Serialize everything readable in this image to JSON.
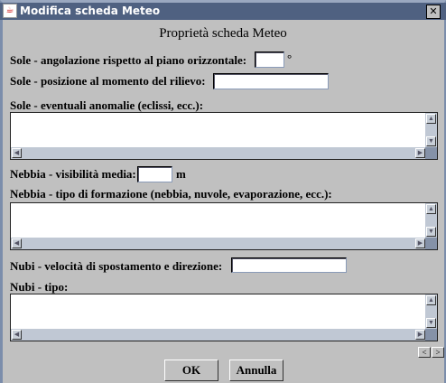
{
  "window": {
    "title": "Modifica scheda Meteo"
  },
  "heading": "Proprietà scheda Meteo",
  "fields": {
    "sole_angolazione": {
      "label": "Sole - angolazione rispetto al piano orizzontale:",
      "value": "",
      "unit": "°"
    },
    "sole_posizione": {
      "label": "Sole - posizione al momento del rilievo:",
      "value": ""
    },
    "sole_anomalie": {
      "label": "Sole - eventuali anomalie (eclissi, ecc.):",
      "value": ""
    },
    "nebbia_visibilita": {
      "label": "Nebbia - visibilità media:",
      "value": "",
      "unit": "m"
    },
    "nebbia_tipo": {
      "label": "Nebbia - tipo di formazione (nebbia, nuvole, evaporazione, ecc.):",
      "value": ""
    },
    "nubi_velocita": {
      "label": "Nubi - velocità di spostamento e direzione:",
      "value": ""
    },
    "nubi_tipo": {
      "label": "Nubi - tipo:",
      "value": ""
    }
  },
  "nav": {
    "prev": "<",
    "next": ">"
  },
  "buttons": {
    "ok": "OK",
    "cancel": "Annulla"
  }
}
